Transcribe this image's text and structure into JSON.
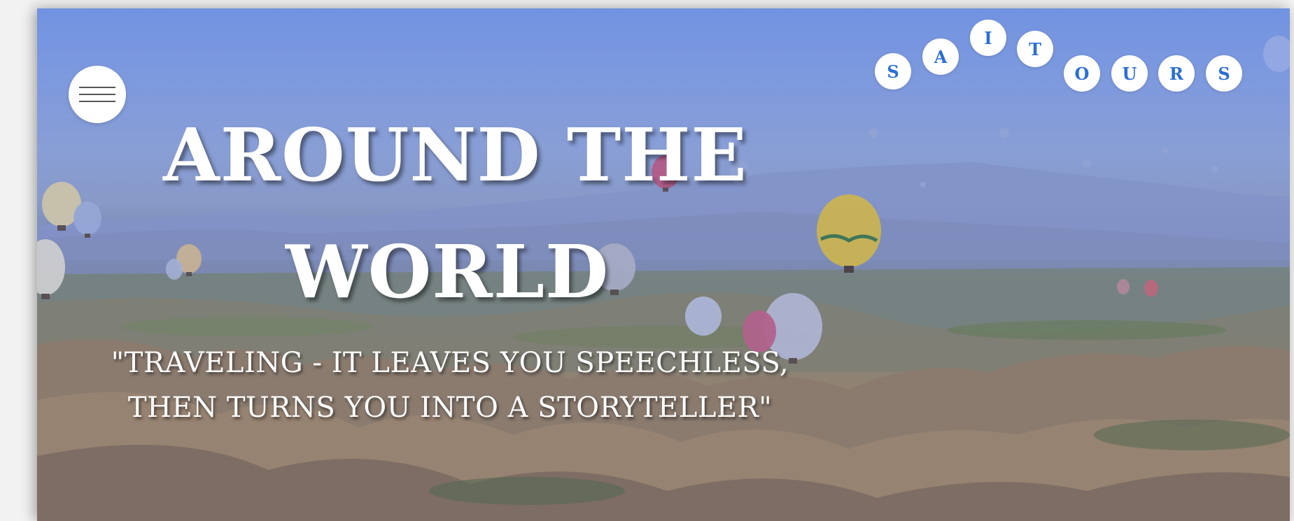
{
  "nav": {
    "menu_icon": "hamburger-icon"
  },
  "logo": {
    "letters": [
      "S",
      "A",
      "I",
      "T",
      "O",
      "U",
      "R",
      "S"
    ]
  },
  "hero": {
    "title_line1": "AROUND THE",
    "title_line2": "WORLD",
    "quote_line1": "\"TRAVELING - IT LEAVES YOU SPEECHLESS,",
    "quote_line2": "THEN TURNS YOU INTO A STORYTELLER\""
  },
  "colors": {
    "accent": "#2a6fd6",
    "sky": "#7b9ee6",
    "text": "#ffffff"
  }
}
